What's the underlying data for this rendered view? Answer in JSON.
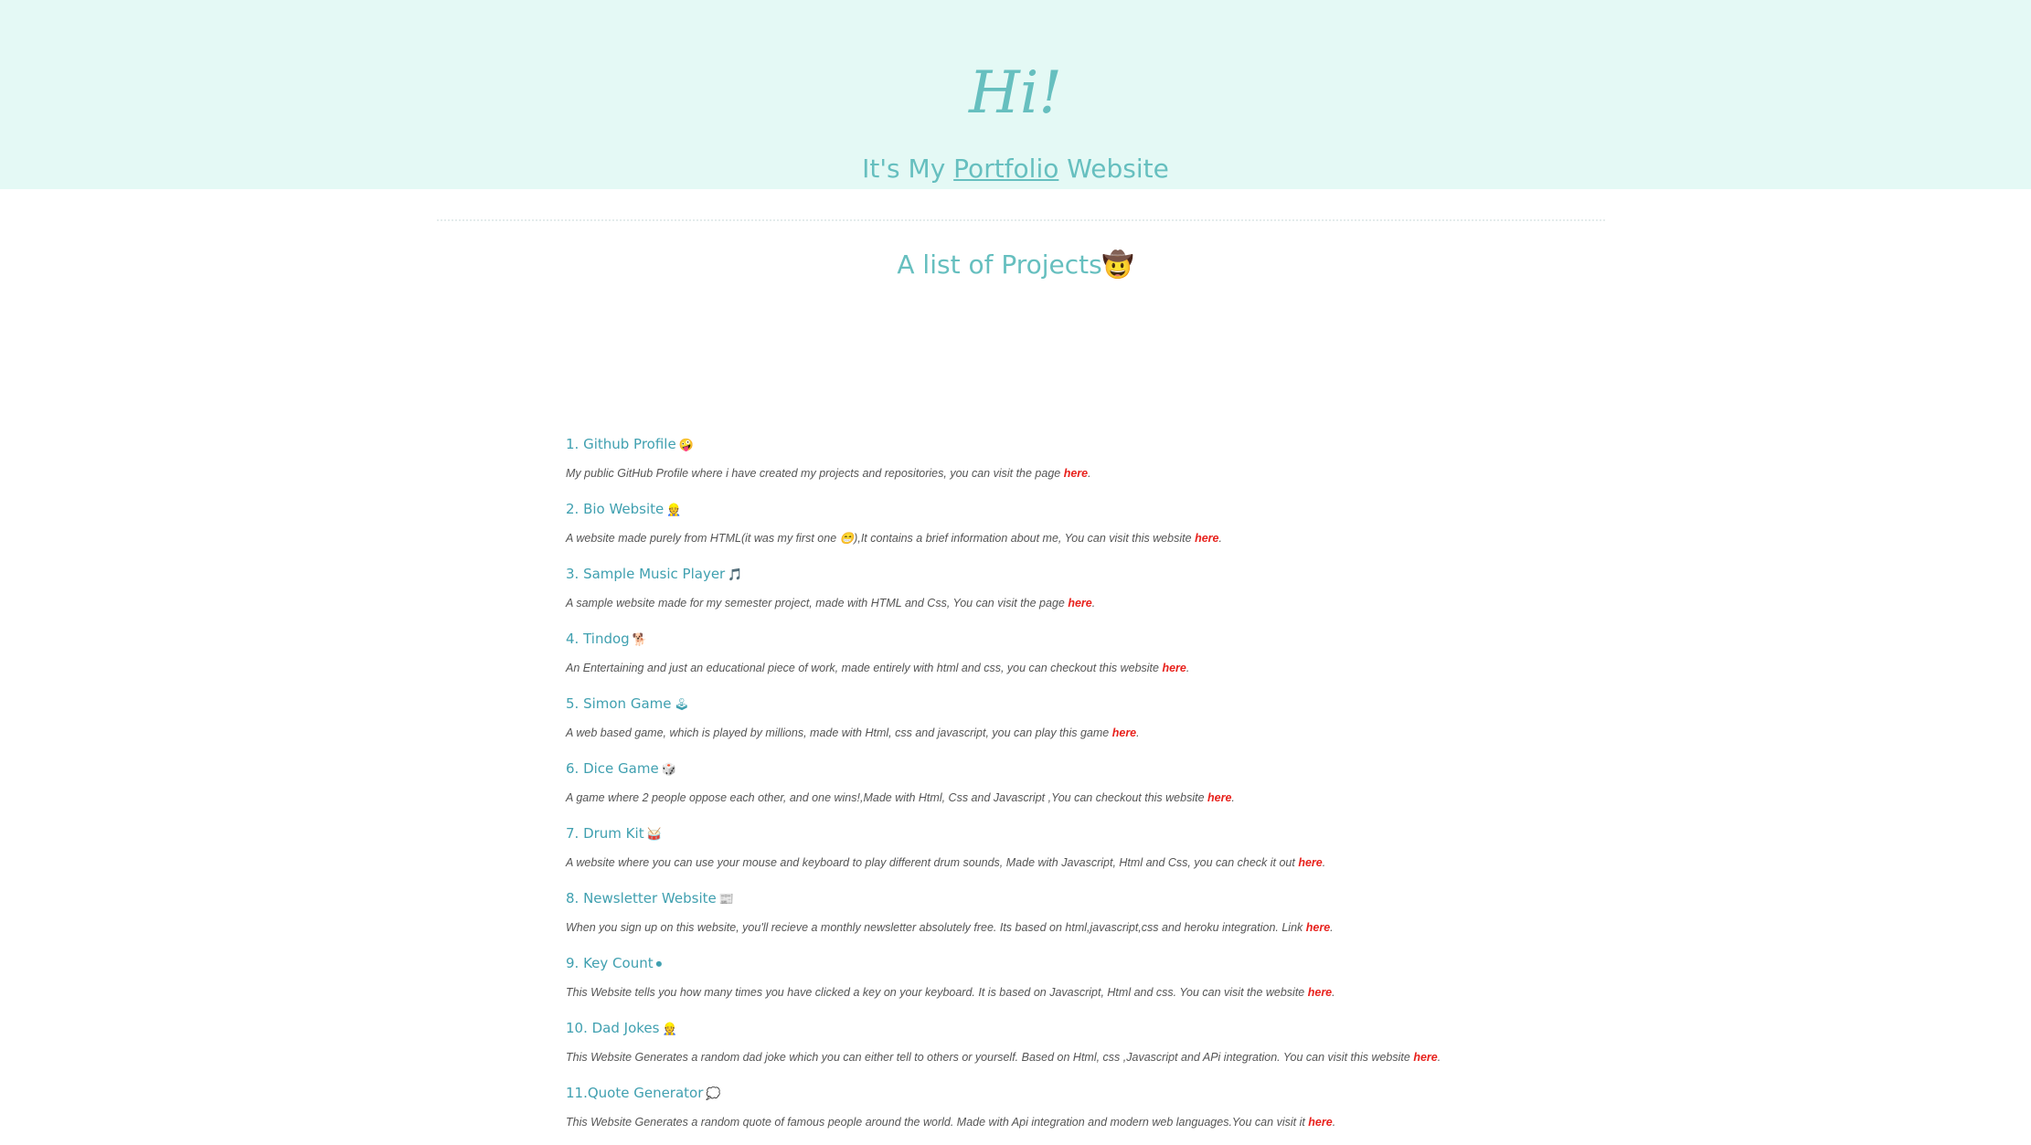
{
  "hero": {
    "title": "Hi!",
    "subtitle_before": "It's My ",
    "subtitle_link": "Portfolio",
    "subtitle_after": " Website"
  },
  "section": {
    "title": "A list of Projects",
    "title_emoji": "🤠"
  },
  "colors": {
    "hero_bg": "#e4f9f5",
    "accent": "#66bfbf",
    "link": "#e8221d"
  },
  "projects": [
    {
      "title": "1. Github Profile",
      "emoji": "🤪",
      "emoji_name": "zany-face-icon",
      "desc": "My public GitHub Profile where i have created my projects and repositories, you can visit the page ",
      "link": "here",
      "tail": "."
    },
    {
      "title": "2. Bio Website",
      "emoji": "👷",
      "emoji_name": "construction-worker-icon",
      "desc": "A website made purely from HTML(it was my first one 😁),It contains a brief information about me, You can visit this website ",
      "link": "here",
      "tail": "."
    },
    {
      "title": "3. Sample Music Player",
      "emoji": "🎵",
      "emoji_name": "music-note-icon",
      "desc": "A sample website made for my semester project, made with HTML and Css, You can visit the page ",
      "link": "here",
      "tail": "."
    },
    {
      "title": "4. Tindog",
      "emoji": "🐕",
      "emoji_name": "dog-icon",
      "desc": "An Entertaining and just an educational piece of work, made entirely with html and css, you can checkout this website ",
      "link": "here",
      "tail": "."
    },
    {
      "title": "5. Simon Game",
      "emoji": "🕹",
      "emoji_name": "joystick-icon",
      "desc": "A web based game, which is played by millions, made with Html, css and javascript, you can play this game ",
      "link": "here",
      "tail": "."
    },
    {
      "title": "6. Dice Game",
      "emoji": "🎲",
      "emoji_name": "dice-icon",
      "desc": "A game where 2 people oppose each other, and one wins!,Made with Html, Css and Javascript ,You can checkout this website ",
      "link": "here",
      "tail": "."
    },
    {
      "title": "7. Drum Kit",
      "emoji": "🥁",
      "emoji_name": "drum-icon",
      "desc": "A website where you can use your mouse and keyboard to play different drum sounds, Made with Javascript, Html and Css, you can check it out ",
      "link": "here",
      "tail": "."
    },
    {
      "title": "8. Newsletter Website",
      "emoji": "📰",
      "emoji_name": "newspaper-icon",
      "desc": "When you sign up on this website, you'll recieve a monthly newsletter absolutely free. Its based on html,javascript,css and heroku integration. Link ",
      "link": "here",
      "tail": "."
    },
    {
      "title": "9. Key Count",
      "emoji": "⏺",
      "emoji_name": "key-button-icon",
      "desc": "This Website tells you how many times you have clicked a key on your keyboard. It is based on Javascript, Html and css. You can visit the website ",
      "link": "here",
      "tail": "."
    },
    {
      "title": "10. Dad Jokes",
      "emoji": "👷",
      "emoji_name": "construction-worker-icon",
      "desc": "This Website Generates a random dad joke which you can either tell to others or yourself. Based on Html, css ,Javascript and APi integration. You can visit this website ",
      "link": "here",
      "tail": "."
    },
    {
      "title": "11.Quote Generator",
      "emoji": "💭",
      "emoji_name": "thought-bubble-icon",
      "desc": "This Website Generates a random quote of famous people around the world. Made with Api integration and modern web languages.You can visit it ",
      "link": "here",
      "tail": "."
    }
  ]
}
